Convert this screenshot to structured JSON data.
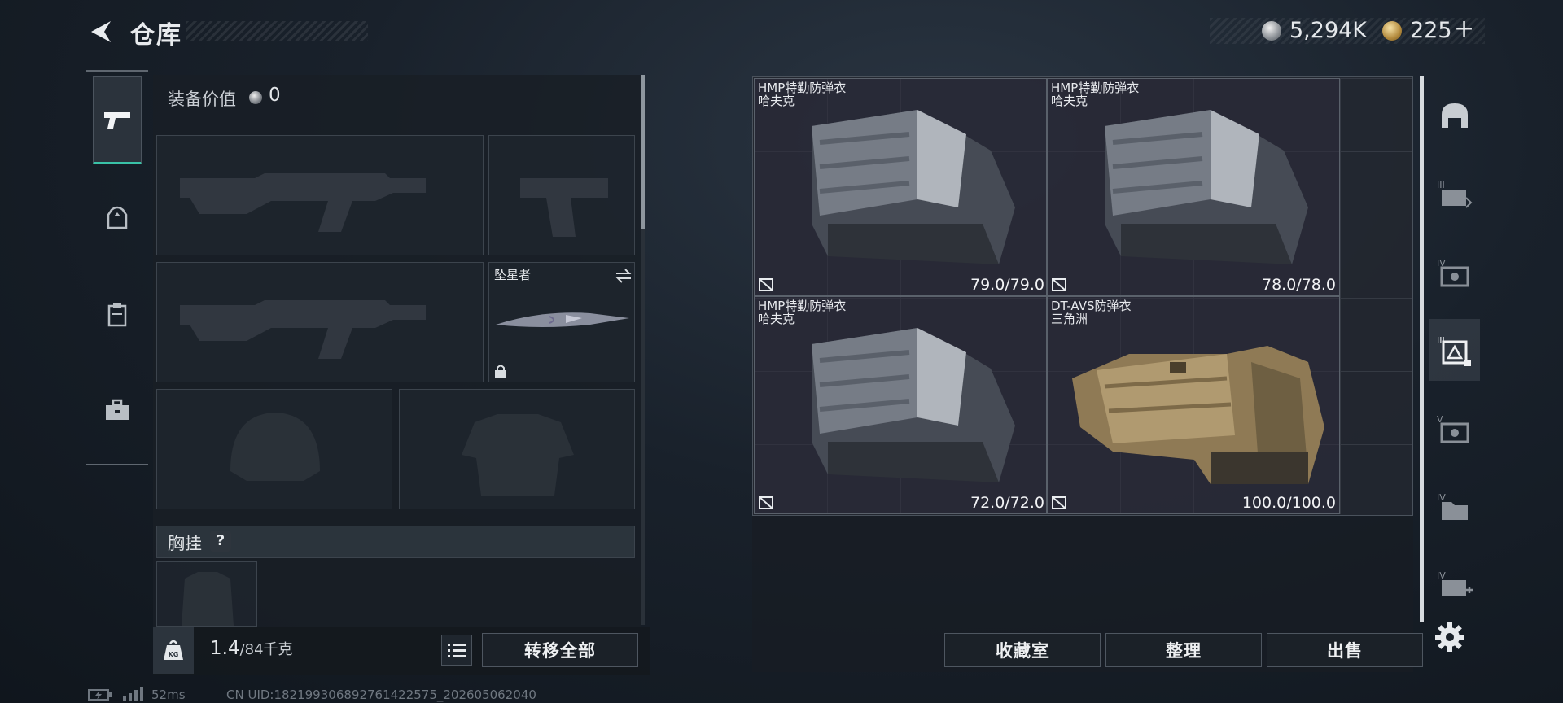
{
  "header": {
    "title": "仓库",
    "currency_silver": "5,294K",
    "currency_gold": "225",
    "add_symbol": "+"
  },
  "left_tabs": [
    {
      "icon": "pistol-icon",
      "active": true
    },
    {
      "icon": "backpack-icon",
      "active": false
    },
    {
      "icon": "vest-icon",
      "active": false
    },
    {
      "icon": "toolbox-icon",
      "active": false
    }
  ],
  "equipment": {
    "value_label": "装备价值",
    "value": "0",
    "melee_slot_name": "坠星者",
    "chest_rig_label": "胸挂",
    "chest_rig_help": "?"
  },
  "weight": {
    "current": "1.4",
    "max": "/84千克"
  },
  "buttons": {
    "transfer_all": "转移全部",
    "collection_room": "收藏室",
    "organize": "整理",
    "sell": "出售"
  },
  "storage_items": [
    {
      "name": "HMP特勤防弹衣",
      "brand": "哈夫克",
      "durability": "79.0/79.0",
      "style": "grey-camo"
    },
    {
      "name": "HMP特勤防弹衣",
      "brand": "哈夫克",
      "durability": "78.0/78.0",
      "style": "grey-camo"
    },
    {
      "name": "HMP特勤防弹衣",
      "brand": "哈夫克",
      "durability": "72.0/72.0",
      "style": "grey-camo"
    },
    {
      "name": "DT-AVS防弹衣",
      "brand": "三角洲",
      "durability": "100.0/100.0",
      "style": "tan"
    }
  ],
  "right_tabs": [
    {
      "icon": "helmet-icon",
      "tier": ""
    },
    {
      "icon": "bag-icon",
      "tier": "III"
    },
    {
      "icon": "case-icon",
      "tier": "IV"
    },
    {
      "icon": "armor-icon",
      "tier": "III",
      "active": true
    },
    {
      "icon": "case-icon",
      "tier": "V"
    },
    {
      "icon": "folder-icon",
      "tier": "IV"
    },
    {
      "icon": "medkit-icon",
      "tier": "IV"
    }
  ],
  "status": {
    "ping": "52ms",
    "uid": "CN UID:18219930689276142​2575_202605062040"
  },
  "colors": {
    "accent": "#39c2a7",
    "panel": "#191f26",
    "item_bg": "#2e2c3c"
  }
}
